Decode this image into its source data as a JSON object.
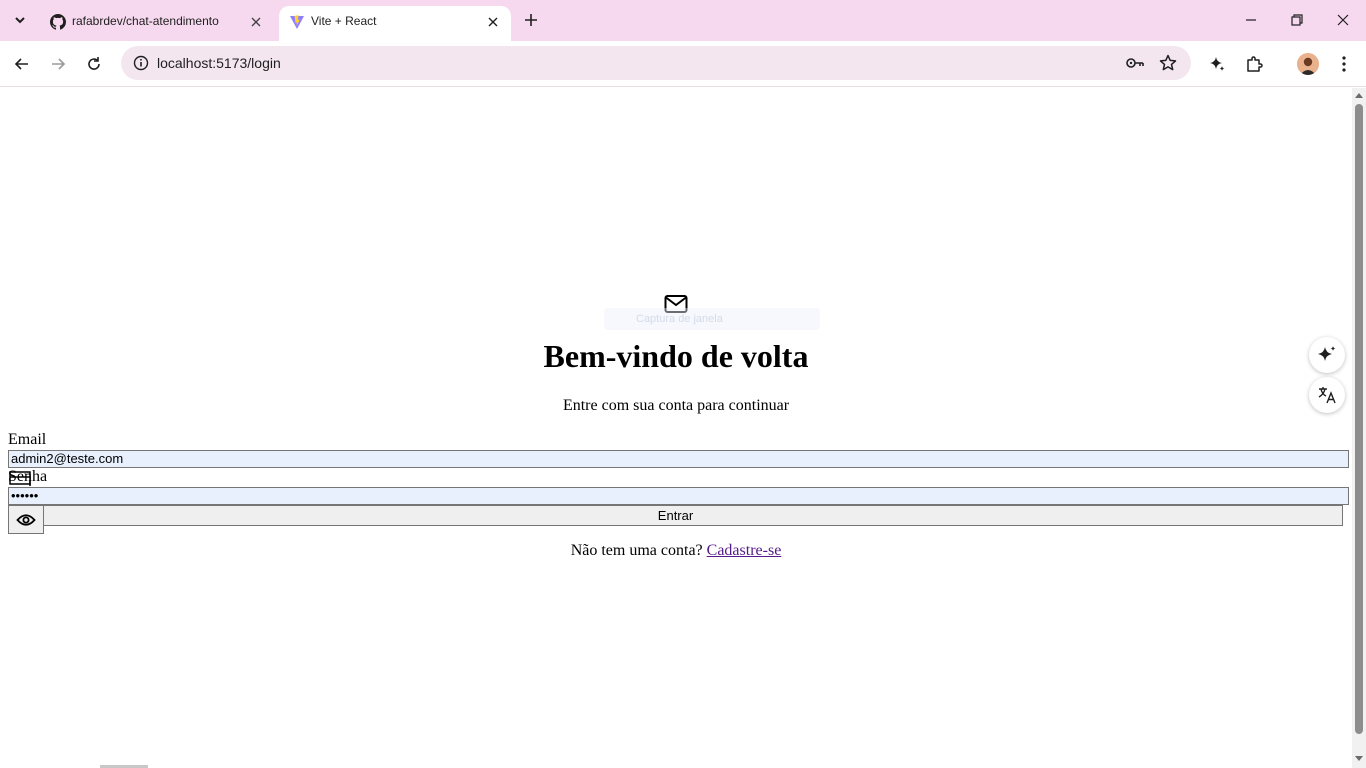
{
  "browser": {
    "tabs": [
      {
        "title": "rafabrdev/chat-atendimento",
        "favicon": "github-icon",
        "active": false
      },
      {
        "title": "Vite + React",
        "favicon": "vite-icon",
        "active": true
      }
    ],
    "address": "localhost:5173/login"
  },
  "page": {
    "title": "Bem-vindo de volta",
    "subtitle": "Entre com sua conta para continuar",
    "capture_hint": "Captura de janela",
    "email_label": "Email",
    "email_value": "admin2@teste.com",
    "password_label": "Senha",
    "password_value": "••••••",
    "submit_label": "Entrar",
    "signup_prompt": "Não tem uma conta?",
    "signup_link": "Cadastre-se"
  },
  "colors": {
    "tabstrip": "#f6d9ee",
    "omnibox": "#f3e6ef",
    "autofill": "#e8f0fe",
    "visited_link": "#551a8b"
  }
}
